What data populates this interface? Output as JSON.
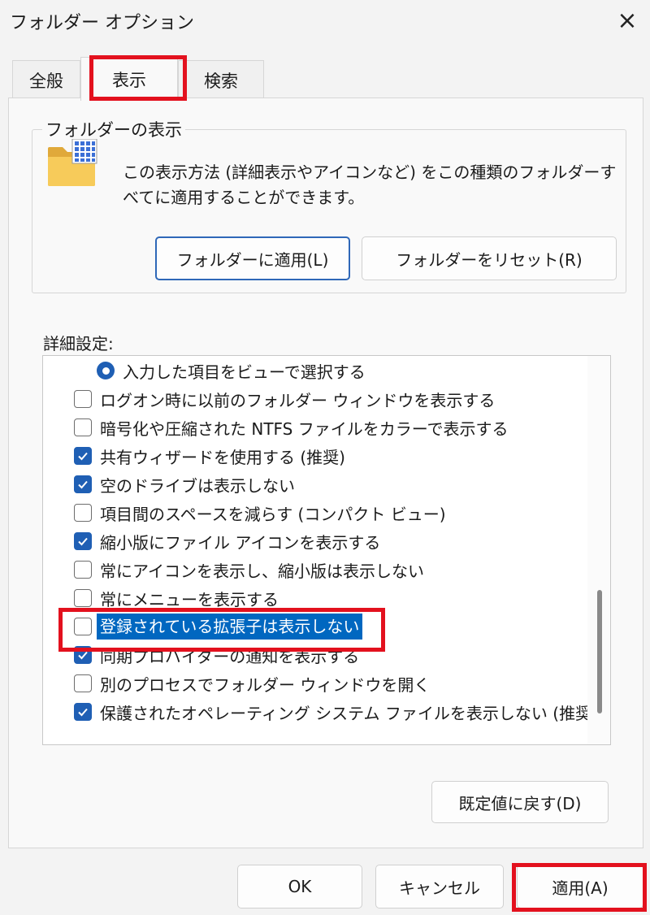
{
  "window": {
    "title": "フォルダー オプション",
    "close_icon": "×"
  },
  "tabs": [
    {
      "label": "全般",
      "active": false
    },
    {
      "label": "表示",
      "active": true
    },
    {
      "label": "検索",
      "active": false
    }
  ],
  "folder_views": {
    "legend": "フォルダーの表示",
    "description": "この表示方法 (詳細表示やアイコンなど) をこの種類のフォルダーすべてに適用することができます。",
    "apply_button": "フォルダーに適用(L)",
    "reset_button": "フォルダーをリセット(R)"
  },
  "advanced": {
    "label": "詳細設定:",
    "items": [
      {
        "type": "radio",
        "checked": true,
        "label": "入力した項目をビューで選択する"
      },
      {
        "type": "checkbox",
        "checked": false,
        "label": "ログオン時に以前のフォルダー ウィンドウを表示する"
      },
      {
        "type": "checkbox",
        "checked": false,
        "label": "暗号化や圧縮された NTFS ファイルをカラーで表示する"
      },
      {
        "type": "checkbox",
        "checked": true,
        "label": "共有ウィザードを使用する (推奨)"
      },
      {
        "type": "checkbox",
        "checked": true,
        "label": "空のドライブは表示しない"
      },
      {
        "type": "checkbox",
        "checked": false,
        "label": "項目間のスペースを減らす (コンパクト ビュー)"
      },
      {
        "type": "checkbox",
        "checked": true,
        "label": "縮小版にファイル アイコンを表示する"
      },
      {
        "type": "checkbox",
        "checked": false,
        "label": "常にアイコンを表示し、縮小版は表示しない"
      },
      {
        "type": "checkbox",
        "checked": false,
        "label": "常にメニューを表示する"
      },
      {
        "type": "checkbox",
        "checked": false,
        "label": "登録されている拡張子は表示しない",
        "selected": true
      },
      {
        "type": "checkbox",
        "checked": true,
        "label": "同期プロバイダーの通知を表示する"
      },
      {
        "type": "checkbox",
        "checked": false,
        "label": "別のプロセスでフォルダー ウィンドウを開く"
      },
      {
        "type": "checkbox",
        "checked": true,
        "label": "保護されたオペレーティング システム ファイルを表示しない (推奨)"
      }
    ],
    "restore_button": "既定値に戻す(D)"
  },
  "footer": {
    "ok": "OK",
    "cancel": "キャンセル",
    "apply": "適用(A)"
  },
  "colors": {
    "accent": "#1f5fb4",
    "highlight": "#0067c0",
    "annotation": "#e3111e"
  }
}
